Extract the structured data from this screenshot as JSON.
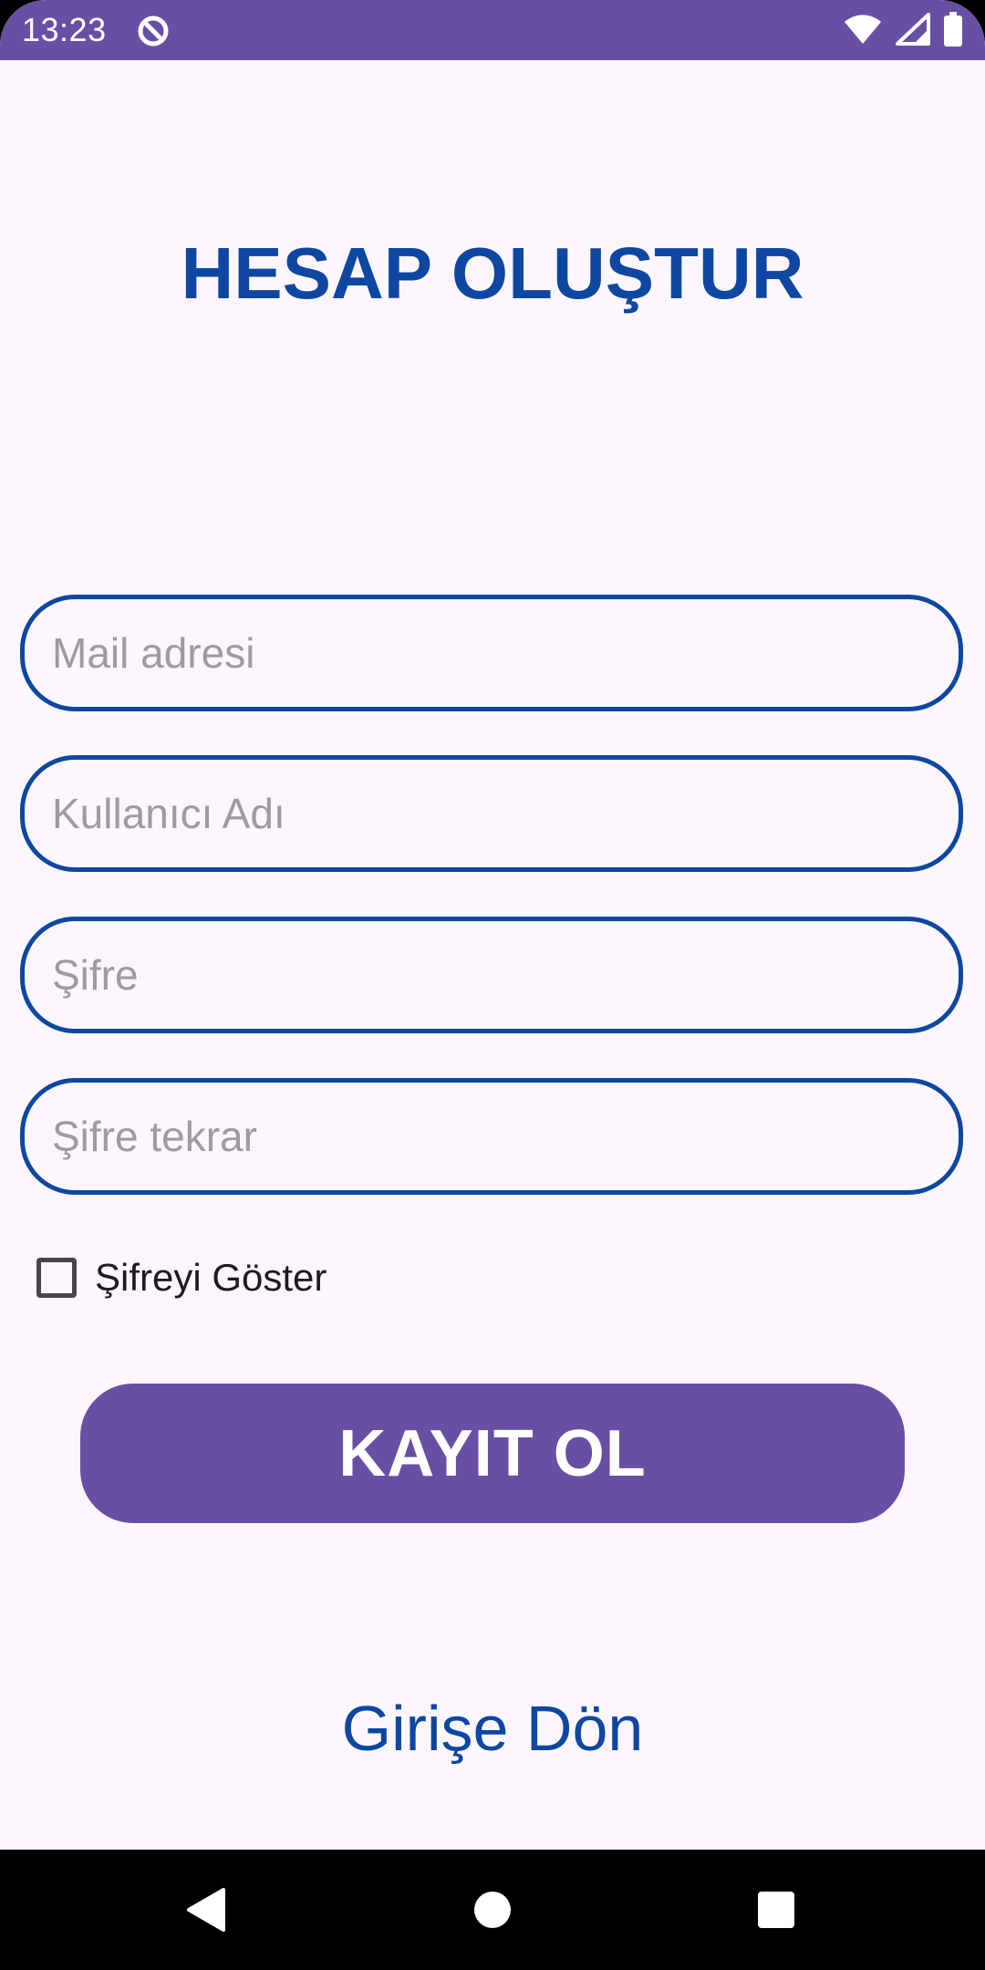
{
  "status_bar": {
    "time": "13:23",
    "app_icon": "data-saver-icon",
    "right_icons": [
      "wifi-icon",
      "cellular-signal-icon",
      "battery-icon"
    ],
    "color": "#6750a4"
  },
  "page": {
    "title": "HESAP OLUŞTUR"
  },
  "form": {
    "email_placeholder": "Mail adresi",
    "username_placeholder": "Kullanıcı Adı",
    "password_placeholder": "Şifre",
    "password_repeat_placeholder": "Şifre tekrar",
    "show_password_label": "Şifreyi Göster",
    "show_password_checked": false
  },
  "actions": {
    "register_label": "KAYIT OL",
    "back_to_login_label": "Girişe Dön"
  },
  "nav_bar": {
    "icons": [
      "back-icon",
      "home-icon",
      "recents-icon"
    ]
  },
  "colors": {
    "accent": "#0d47a1",
    "primary": "#6750a4",
    "background": "#fdf7fd"
  }
}
